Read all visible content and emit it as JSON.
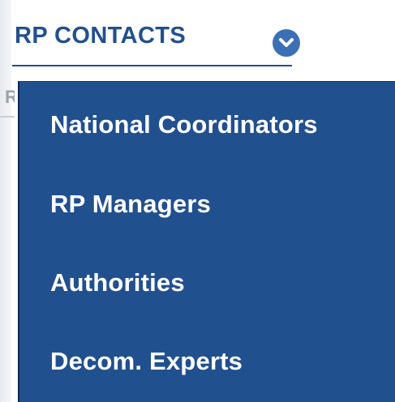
{
  "header": {
    "title": "RP CONTACTS",
    "toggle_icon": "chevron-down-icon"
  },
  "background": {
    "fragment_text": "R"
  },
  "menu": {
    "items": [
      {
        "label": "National Coordinators"
      },
      {
        "label": "RP Managers"
      },
      {
        "label": "Authorities"
      },
      {
        "label": "Decom. Experts"
      }
    ]
  },
  "colors": {
    "primary": "#21508f",
    "accent": "#3b70b6",
    "menu_text": "#ffffff"
  }
}
